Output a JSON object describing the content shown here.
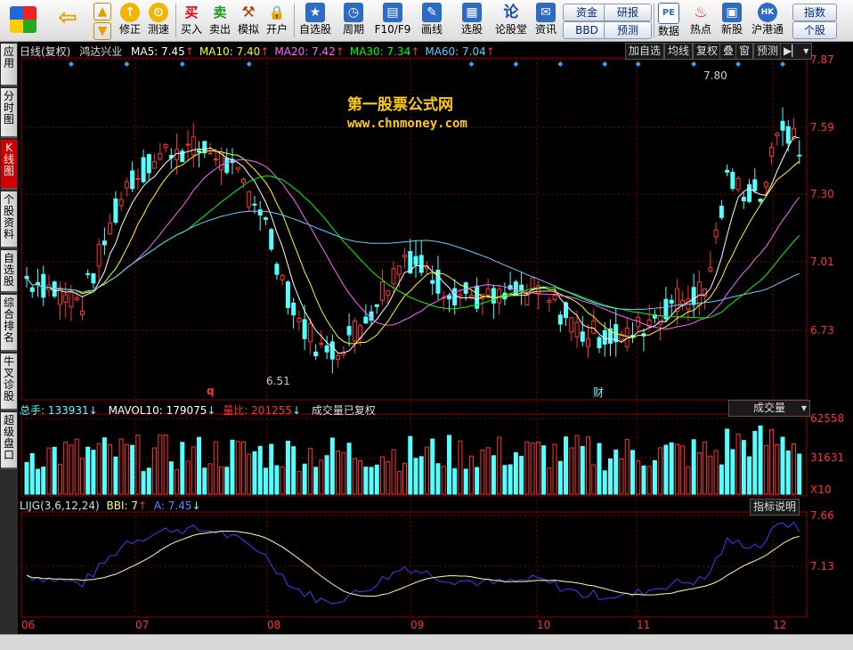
{
  "toolbar": {
    "items": [
      {
        "label": "修正",
        "icon": "↑"
      },
      {
        "label": "测速",
        "icon": "⏲"
      },
      {
        "label": "",
        "icon": "⏰"
      },
      {
        "label": "买入",
        "icon": "买"
      },
      {
        "label": "卖出",
        "icon": "卖"
      },
      {
        "label": "模拟",
        "icon": "⚒"
      },
      {
        "label": "开户",
        "icon": "🔒"
      },
      {
        "label": "自选股",
        "icon": "★"
      },
      {
        "label": "周期",
        "icon": "◷"
      },
      {
        "label": "F10/F9",
        "icon": "▤"
      },
      {
        "label": "画线",
        "icon": "✎"
      },
      {
        "label": "选股",
        "icon": "▦"
      },
      {
        "label": "论股堂",
        "icon": "论"
      },
      {
        "label": "资讯",
        "icon": "✉"
      },
      {
        "label": "数据",
        "icon": "PE"
      },
      {
        "label": "热点",
        "icon": "♨"
      },
      {
        "label": "新股",
        "icon": "▣"
      },
      {
        "label": "沪港通",
        "icon": "HK"
      }
    ],
    "small_buttons": [
      "资金",
      "研报",
      "BBD",
      "预测",
      "指数",
      "个股"
    ]
  },
  "left_tabs": [
    "应用",
    "分时图",
    "K线图",
    "个股资料",
    "自选股",
    "综合排名",
    "牛叉诊股",
    "超级盘口"
  ],
  "main_panel": {
    "title": "日线(复权)",
    "stock_name": "鸿达兴业",
    "ma": [
      {
        "label": "MA5: 7.45",
        "color": "#ffffff"
      },
      {
        "label": "MA10: 7.40",
        "color": "#ffff00"
      },
      {
        "label": "MA20: 7.42",
        "color": "#ff66ff"
      },
      {
        "label": "MA30: 7.34",
        "color": "#00ff00"
      },
      {
        "label": "MA60: 7.04",
        "color": "#66ccff"
      }
    ],
    "buttons": [
      "加自选",
      "均线",
      "复权",
      "叠",
      "窗",
      "预测"
    ],
    "price_ticks": [
      "7.87",
      "7.59",
      "7.30",
      "7.01",
      "6.73"
    ],
    "max_label": "7.80",
    "min_label": "6.51",
    "watermark_title": "第一股票公式网",
    "watermark_url": "www.chnmoney.com",
    "event_marks": [
      "q",
      "财"
    ]
  },
  "volume_panel": {
    "total": "总手: 133931",
    "mavol": "MAVOL10: 179075",
    "ratio": "量比: 201255",
    "note": "成交量已复权",
    "selector": "成交量",
    "ticks": [
      "62558",
      "31631",
      "X10"
    ]
  },
  "indicator_panel": {
    "title": "LIJG(3,6,12,24)",
    "bbi": "BBI: 7",
    "a": "A: 7.45",
    "button": "指标说明",
    "ticks": [
      "7.66",
      "7.13"
    ]
  },
  "months": [
    "06",
    "07",
    "08",
    "09",
    "10",
    "11",
    "12"
  ],
  "colors": {
    "up": "#ff3232",
    "down": "#54ffff",
    "ma5": "#ffffff",
    "ma10": "#ffff00",
    "ma20": "#ff66ff",
    "ma30": "#00ff00",
    "ma60": "#66ccff",
    "accent": "#d40000"
  }
}
